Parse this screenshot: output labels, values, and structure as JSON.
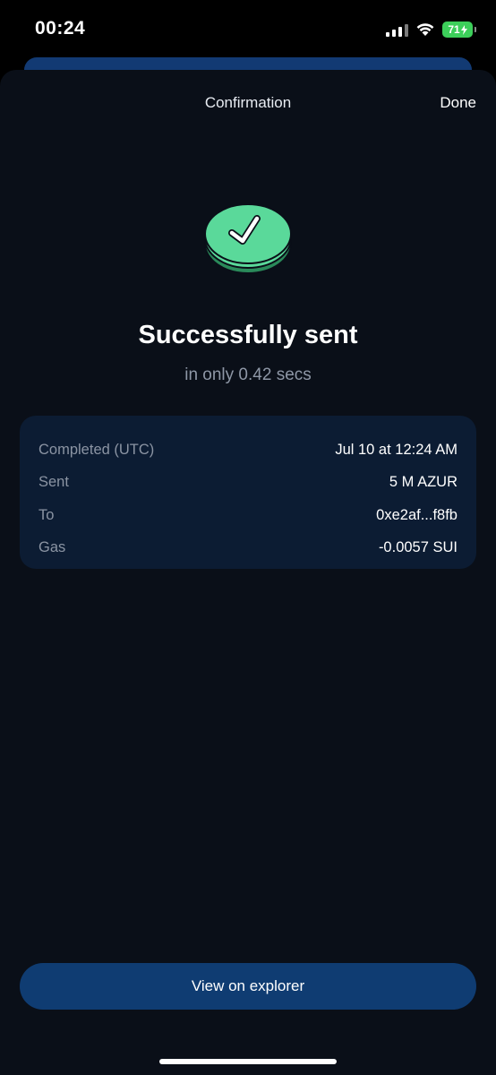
{
  "status_bar": {
    "time": "00:24",
    "battery": "71"
  },
  "sheet": {
    "title": "Confirmation",
    "done_label": "Done"
  },
  "result": {
    "headline": "Successfully sent",
    "subline": "in only 0.42 secs",
    "icon": "check-coin-icon",
    "accent_color": "#5ad99a"
  },
  "details": [
    {
      "label": "Completed (UTC)",
      "value": "Jul 10 at 12:24 AM"
    },
    {
      "label": "Sent",
      "value": "5 M AZUR"
    },
    {
      "label": "To",
      "value": "0xe2af...f8fb"
    },
    {
      "label": "Gas",
      "value": "-0.0057 SUI"
    }
  ],
  "footer": {
    "explorer_label": "View on explorer"
  }
}
